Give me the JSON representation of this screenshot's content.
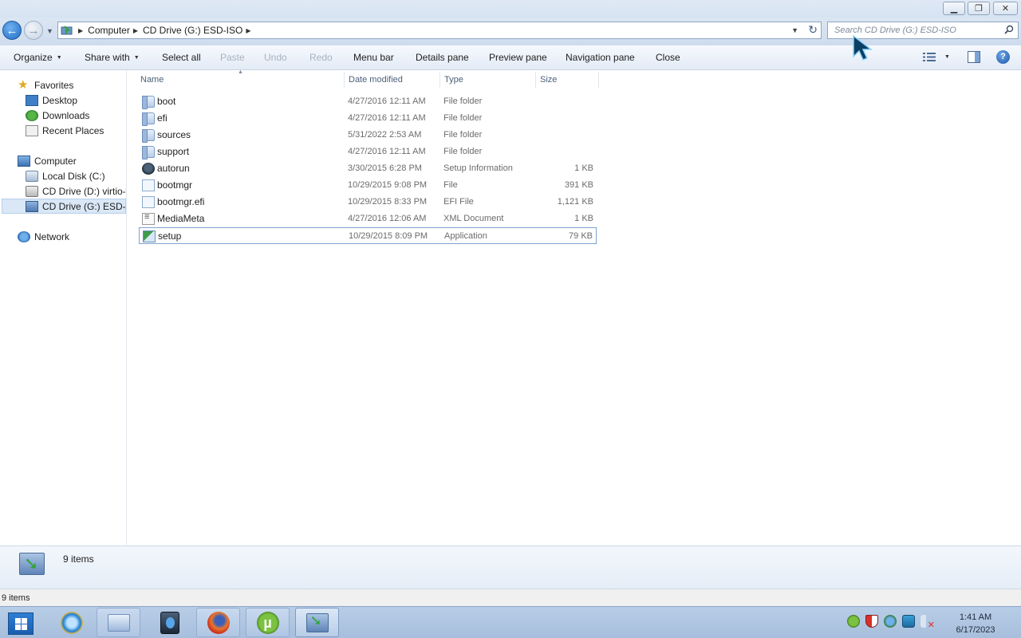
{
  "window": {
    "controls": {
      "minimize": "minimize",
      "maximize": "restore",
      "close": "close"
    }
  },
  "address": {
    "crumbs": [
      "Computer",
      "CD Drive (G:) ESD-ISO"
    ],
    "search_placeholder": "Search CD Drive (G:) ESD-ISO"
  },
  "toolbar": {
    "organize": "Organize",
    "share_with": "Share with",
    "select_all": "Select all",
    "paste": "Paste",
    "undo": "Undo",
    "redo": "Redo",
    "menu_bar": "Menu bar",
    "details_pane": "Details pane",
    "preview_pane": "Preview pane",
    "navigation_pane": "Navigation pane",
    "close": "Close",
    "help": "?"
  },
  "sidebar": {
    "favorites": {
      "label": "Favorites",
      "items": [
        "Desktop",
        "Downloads",
        "Recent Places"
      ]
    },
    "computer": {
      "label": "Computer",
      "items": [
        "Local Disk (C:)",
        "CD Drive (D:) virtio-w",
        "CD Drive (G:) ESD-ISO"
      ]
    },
    "network": {
      "label": "Network"
    }
  },
  "columns": {
    "name": "Name",
    "date": "Date modified",
    "type": "Type",
    "size": "Size"
  },
  "files": [
    {
      "name": "boot",
      "date": "4/27/2016 12:11 AM",
      "type": "File folder",
      "size": ""
    },
    {
      "name": "efi",
      "date": "4/27/2016 12:11 AM",
      "type": "File folder",
      "size": ""
    },
    {
      "name": "sources",
      "date": "5/31/2022 2:53 AM",
      "type": "File folder",
      "size": ""
    },
    {
      "name": "support",
      "date": "4/27/2016 12:11 AM",
      "type": "File folder",
      "size": ""
    },
    {
      "name": "autorun",
      "date": "3/30/2015 6:28 PM",
      "type": "Setup Information",
      "size": "1 KB"
    },
    {
      "name": "bootmgr",
      "date": "10/29/2015 9:08 PM",
      "type": "File",
      "size": "391 KB"
    },
    {
      "name": "bootmgr.efi",
      "date": "10/29/2015 8:33 PM",
      "type": "EFI File",
      "size": "1,121 KB"
    },
    {
      "name": "MediaMeta",
      "date": "4/27/2016 12:06 AM",
      "type": "XML Document",
      "size": "1 KB"
    },
    {
      "name": "setup",
      "date": "10/29/2015 8:09 PM",
      "type": "Application",
      "size": "79 KB"
    }
  ],
  "details": {
    "count": "9 items"
  },
  "status": {
    "text": "9 items"
  },
  "clock": {
    "time": "1:41 AM",
    "date": "6/17/2023"
  },
  "colors": {
    "accent": "#1f6cc4",
    "taskbar": "#a7bfdd",
    "selection": "#d9e7f7"
  }
}
